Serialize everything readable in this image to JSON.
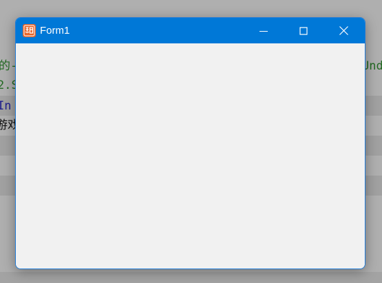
{
  "background": {
    "line1_left": "的-",
    "line1_right": "Und",
    "line2": "2.S",
    "line3": " In",
    "line4": "游戏"
  },
  "window": {
    "title": "Form1",
    "icon": "app-icon",
    "controls": {
      "minimize": "minimize-icon",
      "maximize": "maximize-icon",
      "close": "close-icon"
    }
  },
  "colors": {
    "titlebar": "#0078d7",
    "client": "#f1f1f1",
    "icon": "#e8652a"
  }
}
